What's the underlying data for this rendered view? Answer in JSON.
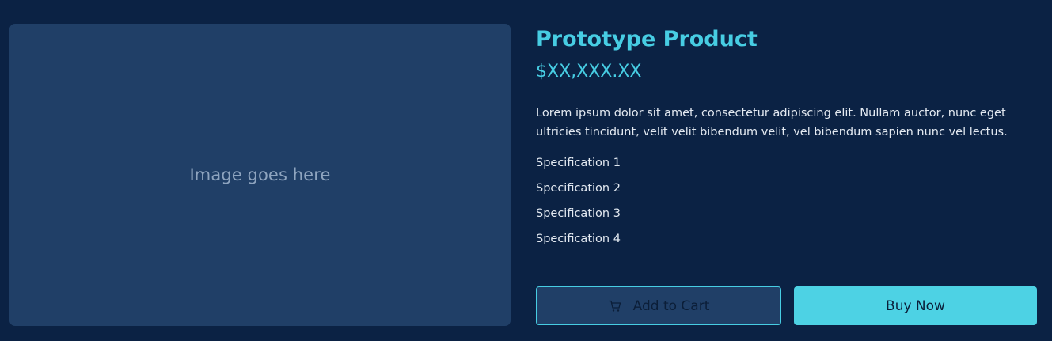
{
  "image": {
    "placeholder": "Image goes here"
  },
  "product": {
    "title": "Prototype Product",
    "price": "$XX,XXX.XX",
    "description": "Lorem ipsum dolor sit amet, consectetur adipiscing elit. Nullam auctor, nunc eget ultricies tincidunt, velit velit bibendum velit, vel bibendum sapien nunc vel lectus.",
    "specifications": [
      "Specification 1",
      "Specification 2",
      "Specification 3",
      "Specification 4"
    ]
  },
  "actions": {
    "add_to_cart_label": "Add to Cart",
    "add_to_cart_icon": "cart-icon",
    "buy_now_label": "Buy Now"
  },
  "colors": {
    "background": "#0b2244",
    "image_panel": "#203f67",
    "accent": "#4dd2e4",
    "text": "#e3e9f1"
  }
}
